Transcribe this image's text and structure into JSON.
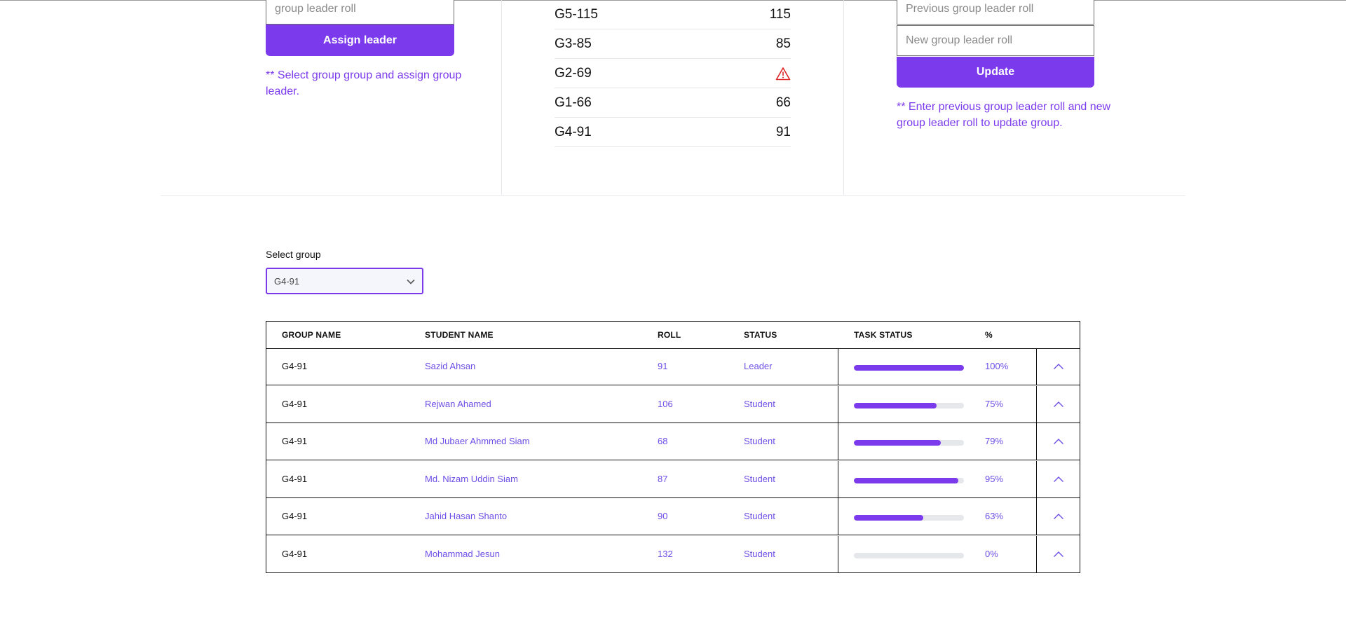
{
  "assign": {
    "leader_placeholder": "group leader roll",
    "button_label": "Assign leader",
    "note": "** Select group group and assign group leader."
  },
  "groups": [
    {
      "name": "G5-115",
      "value": "115",
      "warning": false
    },
    {
      "name": "G3-85",
      "value": "85",
      "warning": false
    },
    {
      "name": "G2-69",
      "value": "",
      "warning": true
    },
    {
      "name": "G1-66",
      "value": "66",
      "warning": false
    },
    {
      "name": "G4-91",
      "value": "91",
      "warning": false
    }
  ],
  "update": {
    "prev_placeholder": "Previous group leader roll",
    "new_placeholder": "New group leader roll",
    "button_label": "Update",
    "note": "** Enter previous group leader roll and new group leader roll to update group."
  },
  "select": {
    "label": "Select group",
    "value": "G4-91"
  },
  "table": {
    "headers": {
      "group_name": "GROUP NAME",
      "student_name": "STUDENT NAME",
      "roll": "ROLL",
      "status": "STATUS",
      "task_status": "TASK STATUS",
      "percent": "%"
    },
    "rows": [
      {
        "group": "G4-91",
        "student": "Sazid Ahsan",
        "roll": "91",
        "status": "Leader",
        "progress": 100,
        "percent": "100%"
      },
      {
        "group": "G4-91",
        "student": "Rejwan Ahamed",
        "roll": "106",
        "status": "Student",
        "progress": 75,
        "percent": "75%"
      },
      {
        "group": "G4-91",
        "student": "Md Jubaer Ahmmed Siam",
        "roll": "68",
        "status": "Student",
        "progress": 79,
        "percent": "79%"
      },
      {
        "group": "G4-91",
        "student": "Md. Nizam Uddin Siam",
        "roll": "87",
        "status": "Student",
        "progress": 95,
        "percent": "95%"
      },
      {
        "group": "G4-91",
        "student": "Jahid Hasan Shanto",
        "roll": "90",
        "status": "Student",
        "progress": 63,
        "percent": "63%"
      },
      {
        "group": "G4-91",
        "student": "Mohammad Jesun",
        "roll": "132",
        "status": "Student",
        "progress": 0,
        "percent": "0%"
      }
    ]
  },
  "colors": {
    "accent": "#7c3aed",
    "link_text": "#6d4ee6",
    "warning": "#dc2626",
    "track": "#e5e7eb"
  }
}
